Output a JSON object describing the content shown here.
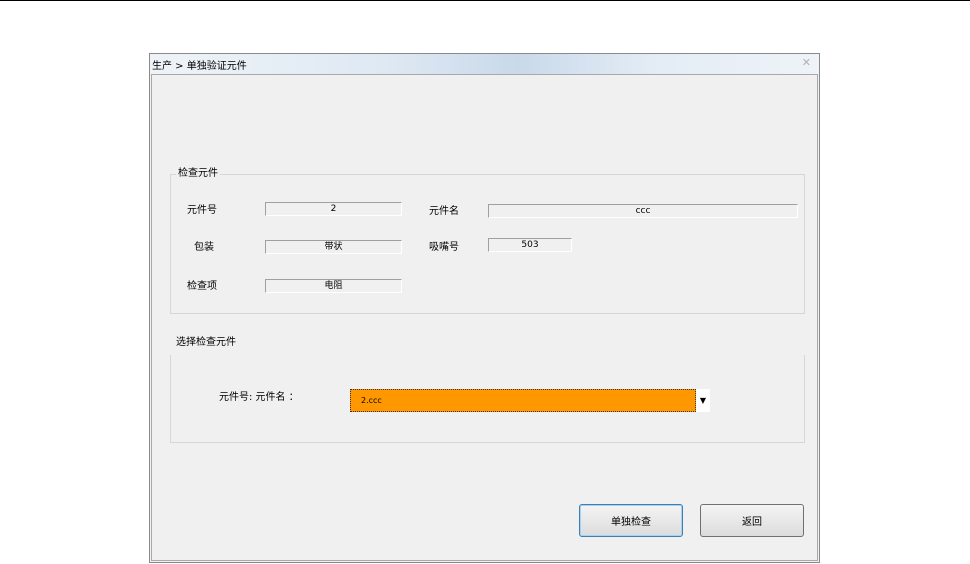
{
  "window": {
    "title": "生产 > 单独验证元件",
    "close_glyph": "✕"
  },
  "check_component": {
    "title": "检查元件",
    "fields": {
      "component_no": {
        "label": "元件号",
        "value": "2"
      },
      "component_name": {
        "label": "元件名",
        "value": "ccc"
      },
      "package": {
        "label": "包装",
        "value": "带状"
      },
      "nozzle_no": {
        "label": "吸嘴号",
        "value": "503"
      },
      "check_item": {
        "label": "检查项",
        "value": "电阻"
      }
    }
  },
  "select_component": {
    "title": "选择检查元件",
    "combo_label": "元件号: 元件名 ：",
    "combo_value": "2.ccc",
    "combo_highlight_color": "#ff9800"
  },
  "buttons": {
    "single_check": "单独检查",
    "back": "返回"
  }
}
